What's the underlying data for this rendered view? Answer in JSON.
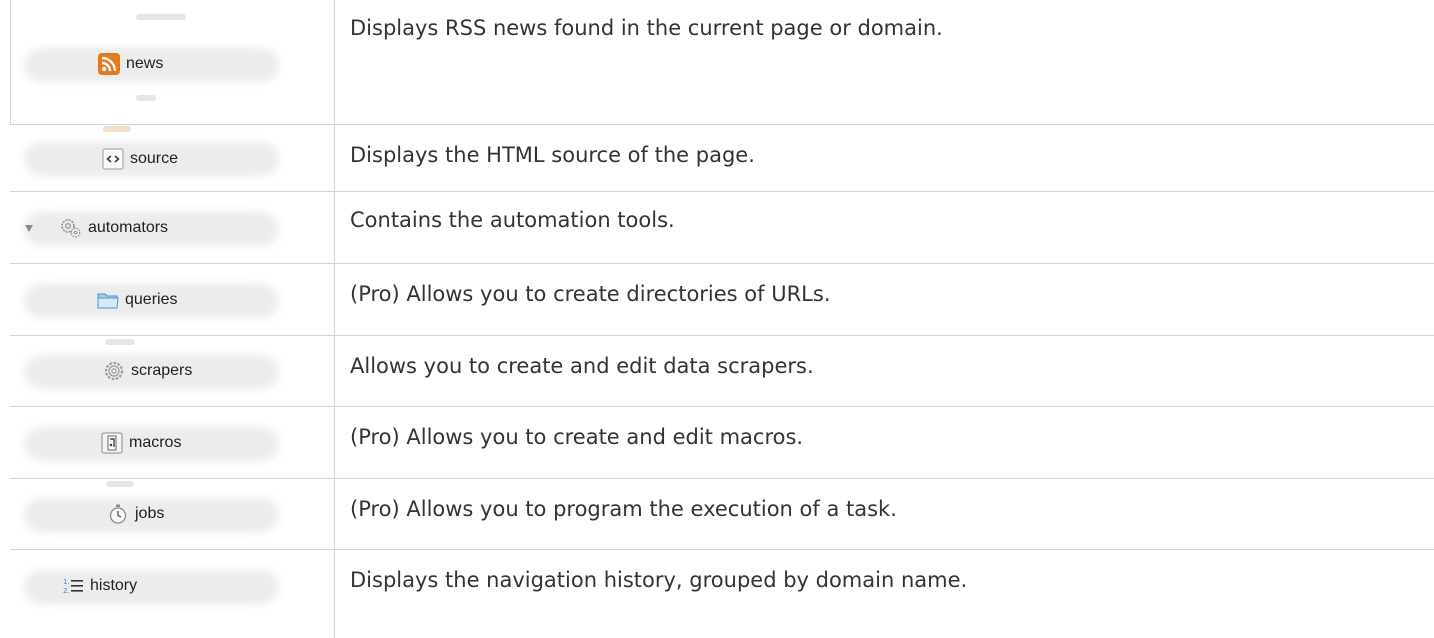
{
  "rows": [
    {
      "icon": "rss-icon",
      "label": "news",
      "description": "Displays RSS news found in the current page or domain."
    },
    {
      "icon": "source-code-icon",
      "label": "source",
      "description": "Displays the HTML source of the page."
    },
    {
      "icon": "automators-gears-icon",
      "label": "automators",
      "description": "Contains the automation tools."
    },
    {
      "icon": "folder-icon",
      "label": "queries",
      "description": "(Pro) Allows you to create directories of URLs."
    },
    {
      "icon": "gear-icon",
      "label": "scrapers",
      "description": "Allows you to create and edit data scrapers."
    },
    {
      "icon": "macro-icon",
      "label": "macros",
      "description": "(Pro) Allows you to create and edit macros."
    },
    {
      "icon": "stopwatch-icon",
      "label": "jobs",
      "description": "(Pro) Allows you to program the execution of a task."
    },
    {
      "icon": "numbered-list-icon",
      "label": "history",
      "description": "Displays the navigation history, grouped by domain name."
    }
  ],
  "colors": {
    "rule": "#d4d4d4",
    "rss_orange": "#e8781c",
    "folder_blue": "#6aa7e0",
    "text": "#333333"
  }
}
